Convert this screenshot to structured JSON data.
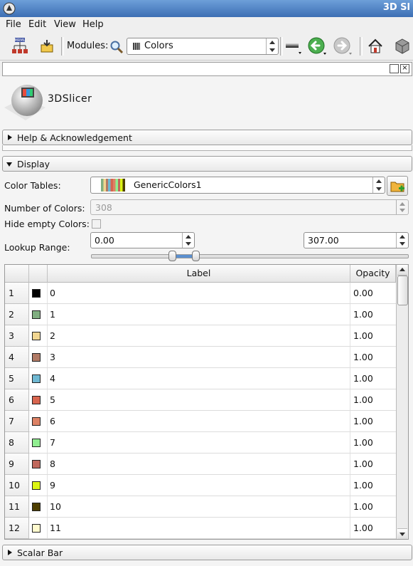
{
  "window": {
    "title": "3D Sl"
  },
  "menu": [
    {
      "label": "File"
    },
    {
      "label": "Edit"
    },
    {
      "label": "View"
    },
    {
      "label": "Help"
    }
  ],
  "toolbar": {
    "modules_label": "Modules:",
    "module_selected": "Colors"
  },
  "logo": {
    "text": "3DSlicer"
  },
  "sections": {
    "help": "Help & Acknowledgement",
    "display": "Display",
    "scalar_bar": "Scalar Bar"
  },
  "display": {
    "color_tables_label": "Color Tables:",
    "color_table_value": "GenericColors1",
    "num_colors_label": "Number of Colors:",
    "num_colors_value": "308",
    "hide_empty_label": "Hide empty Colors:",
    "hide_empty_checked": false,
    "lookup_range_label": "Lookup Range:",
    "range_min": "0.00",
    "range_max": "307.00"
  },
  "table": {
    "columns": [
      "",
      "",
      "Label",
      "Opacity"
    ],
    "rows": [
      {
        "index": "1",
        "color": "#000000",
        "label": "0",
        "opacity": "0.00"
      },
      {
        "index": "2",
        "color": "#80ae80",
        "label": "1",
        "opacity": "1.00"
      },
      {
        "index": "3",
        "color": "#f1d691",
        "label": "2",
        "opacity": "1.00"
      },
      {
        "index": "4",
        "color": "#b17a65",
        "label": "3",
        "opacity": "1.00"
      },
      {
        "index": "5",
        "color": "#6fb8d2",
        "label": "4",
        "opacity": "1.00"
      },
      {
        "index": "6",
        "color": "#d8654f",
        "label": "5",
        "opacity": "1.00"
      },
      {
        "index": "7",
        "color": "#dd8265",
        "label": "6",
        "opacity": "1.00"
      },
      {
        "index": "8",
        "color": "#90ee90",
        "label": "7",
        "opacity": "1.00"
      },
      {
        "index": "9",
        "color": "#c0685c",
        "label": "8",
        "opacity": "1.00"
      },
      {
        "index": "10",
        "color": "#dcf514",
        "label": "9",
        "opacity": "1.00"
      },
      {
        "index": "11",
        "color": "#4e3f00",
        "label": "10",
        "opacity": "1.00"
      },
      {
        "index": "12",
        "color": "#ffface",
        "label": "11",
        "opacity": "1.00"
      }
    ]
  },
  "colors": {
    "accent": "#3d6fb4",
    "panel_bg": "#f4f4f4"
  }
}
